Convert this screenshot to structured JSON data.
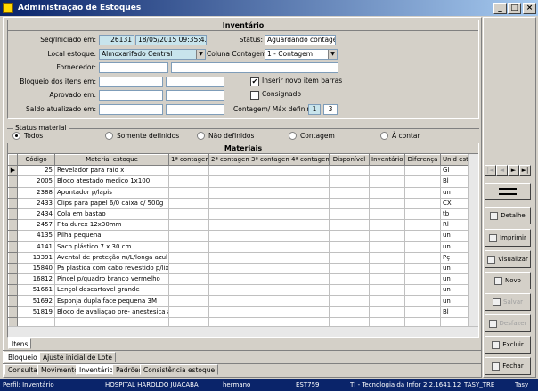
{
  "window": {
    "title": "Administração de Estoques",
    "controls": [
      "_",
      "□",
      "×"
    ]
  },
  "inventario": {
    "header": "Inventário",
    "seq_label": "Seq/Iniciado em:",
    "seq_value": "26131",
    "date_value": "18/05/2015 09:35:43",
    "status_label": "Status:",
    "status_value": "Aguardando contagem",
    "local_label": "Local estoque:",
    "local_value": "Almoxarifado Central",
    "coluna_label": "Coluna Contagem:",
    "coluna_value": "1 - Contagem",
    "fornecedor_label": "Fornecedor:",
    "bloqueio_label": "Bloqueio dos itens em:",
    "aprovado_label": "Aprovado em:",
    "saldo_label": "Saldo atualizado em:",
    "inserir_label": "Inserir novo item barras",
    "inserir_checked": true,
    "consignado_label": "Consignado",
    "consignado_checked": false,
    "contagem_label": "Contagem/ Máx definir:",
    "contagem_value": "1",
    "max_value": "3"
  },
  "status_material": {
    "legend": "Status material",
    "options": [
      "Todos",
      "Somente definidos",
      "Não definidos",
      "Contagem",
      "À contar"
    ],
    "selected": 0
  },
  "materiais": {
    "header": "Materiais",
    "columns": [
      "Código",
      "Material estoque",
      "1ª contagem",
      "2ª contagem",
      "3ª contagem",
      "4ª contagem",
      "Disponível",
      "Inventário",
      "Diferença",
      "Unid esto"
    ],
    "rows": [
      {
        "codigo": "25",
        "material": "Revelador para raio x",
        "unid": "Gl"
      },
      {
        "codigo": "2005",
        "material": "Bloco atestado medico 1x100",
        "unid": "Bl"
      },
      {
        "codigo": "2388",
        "material": "Apontador p/lapis",
        "unid": "un"
      },
      {
        "codigo": "2433",
        "material": "Clips para papel 6/0 caixa c/ 500g",
        "unid": "CX"
      },
      {
        "codigo": "2434",
        "material": "Cola em bastao",
        "unid": "tb"
      },
      {
        "codigo": "2457",
        "material": "Fita durex 12x30mm",
        "unid": "Rl"
      },
      {
        "codigo": "4135",
        "material": "Pilha pequena",
        "unid": "un"
      },
      {
        "codigo": "4141",
        "material": "Saco plástico 7 x 30 cm",
        "unid": "un"
      },
      {
        "codigo": "13391",
        "material": "Avental de proteção m/L/longa azul claro",
        "unid": "Pç"
      },
      {
        "codigo": "15840",
        "material": "Pa plastica com cabo revestido p/lixo",
        "unid": "un"
      },
      {
        "codigo": "16812",
        "material": "Pincel p/quadro branco  vermelho",
        "unid": "un"
      },
      {
        "codigo": "51661",
        "material": "Lençol descartavel grande",
        "unid": "un"
      },
      {
        "codigo": "51692",
        "material": "Esponja dupla face pequena 3M",
        "unid": "un"
      },
      {
        "codigo": "51819",
        "material": "Bloco de avaliaçao pre- anestesica ambulatorial",
        "unid": "Bl"
      }
    ],
    "empty_rows": 1
  },
  "inner_tabs": [
    "Itens"
  ],
  "sub_tabs": [
    "Bloqueio",
    "Ajuste inicial de Lote"
  ],
  "bottom_tabs": [
    "Consulta",
    "Movimento",
    "Inventário",
    "Padrões",
    "Consistência estoque"
  ],
  "bottom_tab_active": 2,
  "side_buttons": [
    {
      "label": "Detalhe",
      "icon": "detail-icon",
      "enabled": true
    },
    {
      "label": "Imprimir",
      "icon": "printer-icon",
      "enabled": true
    },
    {
      "label": "Visualizar",
      "icon": "preview-icon",
      "enabled": true
    },
    {
      "label": "Novo",
      "icon": "new-icon",
      "enabled": true
    },
    {
      "label": "Salvar",
      "icon": "save-icon",
      "enabled": false
    },
    {
      "label": "Desfazer",
      "icon": "undo-icon",
      "enabled": false
    },
    {
      "label": "Excluir",
      "icon": "delete-icon",
      "enabled": true
    },
    {
      "label": "Fechar",
      "icon": "close-door-icon",
      "enabled": true
    }
  ],
  "nav_buttons": [
    "|◄",
    "◄",
    "►",
    "►|"
  ],
  "statusbar": {
    "perfil": "Perfil: Inventário",
    "hospital": "HOSPITAL HAROLDO JUACABA",
    "user": "hermano",
    "est": "EST759",
    "ti": "TI - Tecnologia da Informa",
    "version": "2.2.1641.12",
    "db": "TASY_TRE",
    "app": "Tasy"
  }
}
